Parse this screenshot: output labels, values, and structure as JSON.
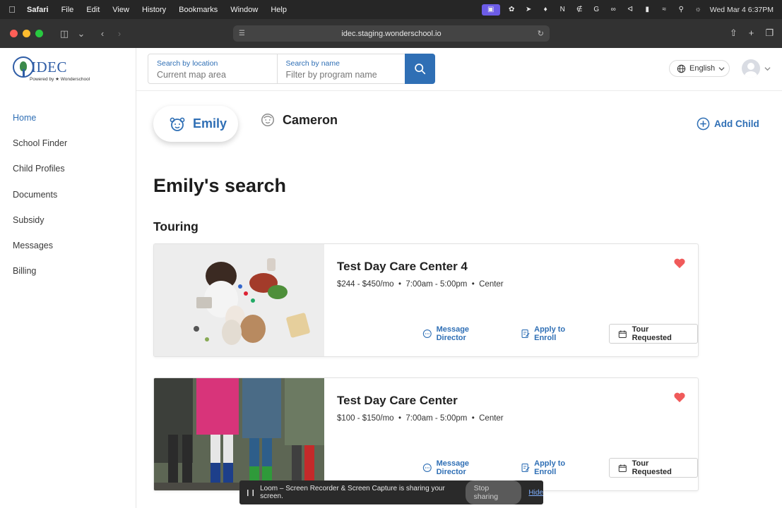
{
  "menubar": {
    "app_name": "Safari",
    "items": [
      "File",
      "Edit",
      "View",
      "History",
      "Bookmarks",
      "Window",
      "Help"
    ],
    "clock": "Wed Mar 4  6:37PM"
  },
  "browser": {
    "url": "idec.staging.wonderschool.io"
  },
  "logo": {
    "brand": "IDEC",
    "powered_by": "Powered by ★ Wonderschool"
  },
  "sidebar": {
    "items": [
      {
        "label": "Home",
        "active": true
      },
      {
        "label": "School Finder"
      },
      {
        "label": "Child Profiles"
      },
      {
        "label": "Documents"
      },
      {
        "label": "Subsidy"
      },
      {
        "label": "Messages"
      },
      {
        "label": "Billing"
      }
    ]
  },
  "search": {
    "location_label": "Search by location",
    "location_placeholder": "Current map area",
    "name_label": "Search by name",
    "name_placeholder": "Filter by program name"
  },
  "header": {
    "language": "English"
  },
  "children": {
    "tabs": [
      {
        "name": "Emily",
        "active": true
      },
      {
        "name": "Cameron",
        "active": false
      }
    ],
    "add_label": "Add Child"
  },
  "main": {
    "title": "Emily's search",
    "section": "Touring"
  },
  "schools": [
    {
      "name": "Test Day Care Center 4",
      "price": "$244 - $450/mo",
      "hours": "7:00am - 5:00pm",
      "type": "Center",
      "message_label": "Message Director",
      "apply_label": "Apply to Enroll",
      "tour_label": "Tour Requested"
    },
    {
      "name": "Test Day Care Center",
      "price": "$100 - $150/mo",
      "hours": "7:00am - 5:00pm",
      "type": "Center",
      "message_label": "Message Director",
      "apply_label": "Apply to Enroll",
      "tour_label": "Tour Requested"
    }
  ],
  "sharing": {
    "message": "Loom – Screen Recorder & Screen Capture is sharing your screen.",
    "stop_label": "Stop sharing",
    "hide_label": "Hide"
  },
  "colors": {
    "accent": "#2f6fb5",
    "heart": "#f05a5a"
  },
  "icons": {
    "search": "search-icon",
    "globe": "globe-icon",
    "heart": "heart-icon",
    "message": "message-icon",
    "apply": "apply-icon",
    "calendar": "calendar-icon",
    "add": "plus-circle-icon"
  }
}
